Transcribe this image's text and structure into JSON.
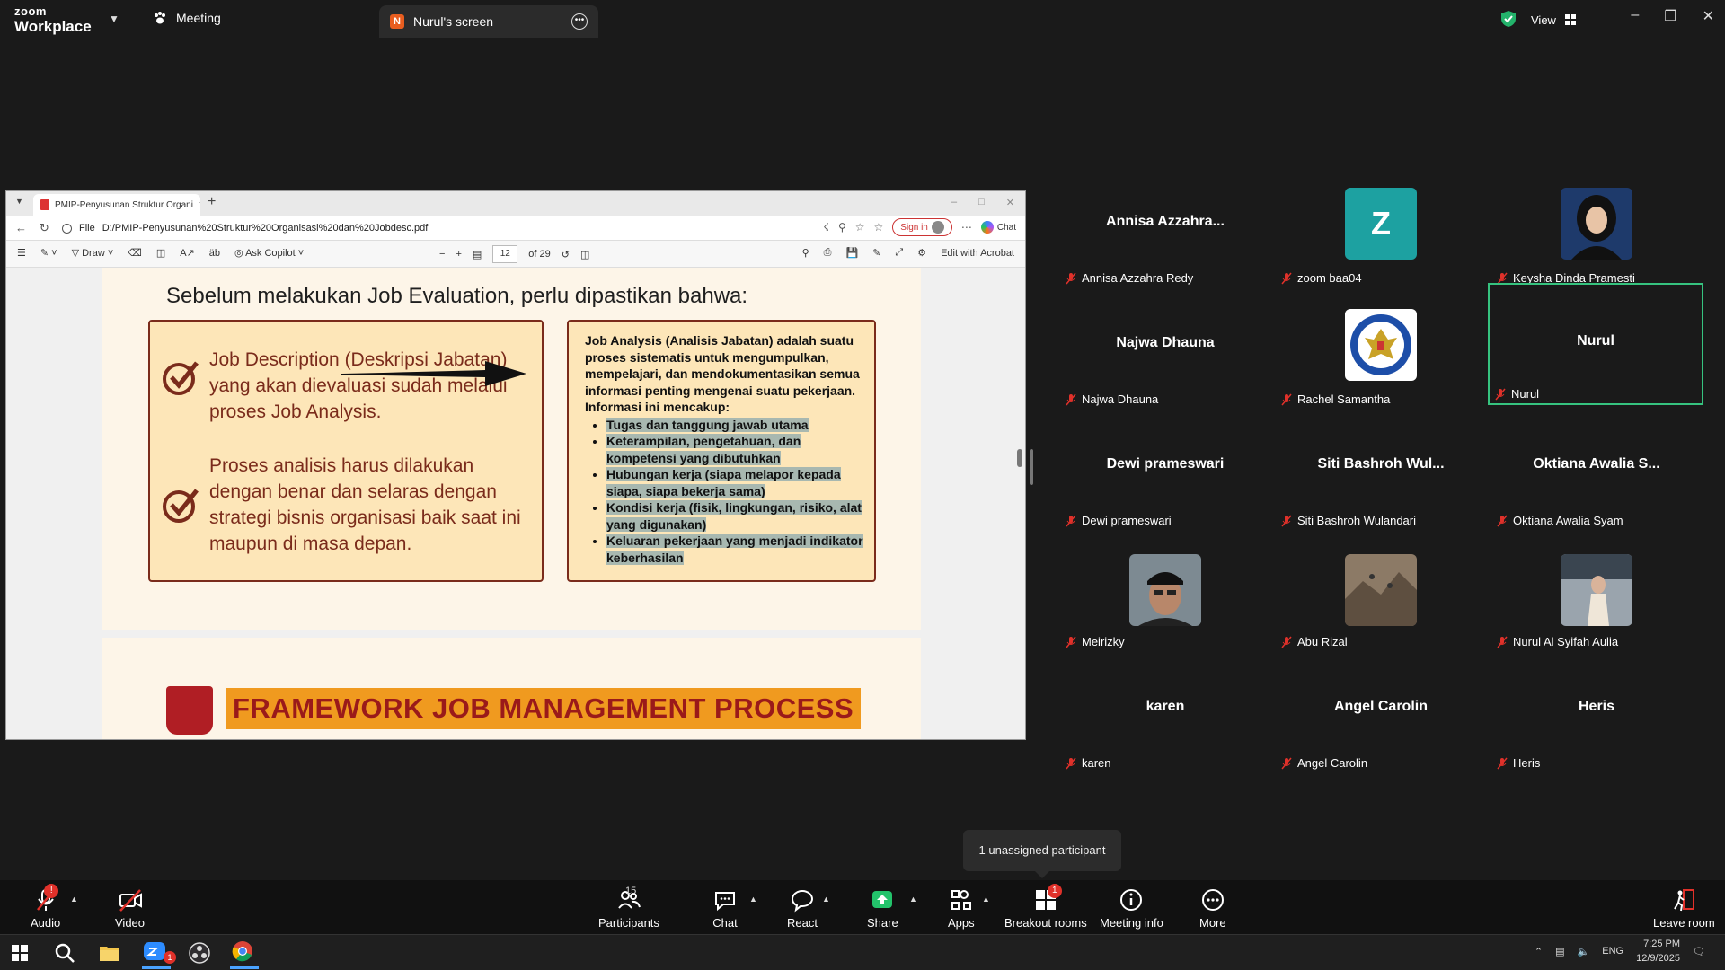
{
  "app": {
    "logo_top": "zoom",
    "logo_bottom": "Workplace",
    "meeting_label": "Meeting",
    "screen_tab_badge": "N",
    "screen_tab_label": "Nurul's screen",
    "view_label": "View"
  },
  "browser": {
    "tab_title": "PMIP-Penyusunan Struktur Organi",
    "url_prefix": "File",
    "url": "D:/PMIP-Penyusunan%20Struktur%20Organisasi%20dan%20Jobdesc.pdf",
    "signin_label": "Sign in",
    "chat_label": "Chat",
    "draw_label": "Draw",
    "copilot_label": "Ask Copilot",
    "page_current": "12",
    "page_total": "of 29",
    "edit_label": "Edit with Acrobat"
  },
  "pdf": {
    "heading": "Sebelum melakukan Job Evaluation, perlu dipastikan bahwa:",
    "left_point_1": "Job Description (Deskripsi Jabatan) yang akan dievaluasi sudah melalui proses Job Analysis.",
    "left_point_2": "Proses analisis harus dilakukan dengan benar dan selaras dengan strategi bisnis organisasi baik saat ini maupun di masa depan.",
    "right_intro": "Job Analysis (Analisis Jabatan) adalah suatu proses sistematis untuk mengumpulkan, mempelajari, dan mendokumentasikan semua informasi penting mengenai suatu pekerjaan. Informasi ini mencakup:",
    "right_items": [
      "Tugas dan tanggung jawab utama",
      "Keterampilan, pengetahuan, dan kompetensi yang dibutuhkan",
      "Hubungan kerja (siapa melapor kepada siapa, siapa bekerja sama)",
      "Kondisi kerja (fisik, lingkungan, risiko, alat yang digunakan)",
      "Keluaran pekerjaan yang menjadi indikator keberhasilan"
    ],
    "next_page_title": "FRAMEWORK JOB MANAGEMENT PROCESS"
  },
  "gallery": {
    "tiles": [
      {
        "big": "Annisa Azzahra...",
        "label": "Annisa Azzahra Redy"
      },
      {
        "big": "Z",
        "label": "zoom baa04"
      },
      {
        "big": "",
        "label": "Keysha Dinda Pramesti"
      },
      {
        "big": "Najwa Dhauna",
        "label": "Najwa Dhauna"
      },
      {
        "big": "",
        "label": "Rachel Samantha"
      },
      {
        "big": "Nurul",
        "label": "Nurul"
      },
      {
        "big": "Dewi prameswari",
        "label": "Dewi prameswari"
      },
      {
        "big": "Siti Bashroh Wul...",
        "label": "Siti Bashroh Wulandari"
      },
      {
        "big": "Oktiana Awalia S...",
        "label": "Oktiana Awalia Syam"
      },
      {
        "big": "",
        "label": "Meirizky"
      },
      {
        "big": "",
        "label": "Abu Rizal"
      },
      {
        "big": "",
        "label": "Nurul Al Syifah Aulia"
      },
      {
        "big": "karen",
        "label": "karen"
      },
      {
        "big": "Angel Carolin",
        "label": "Angel Carolin"
      },
      {
        "big": "Heris",
        "label": "Heris"
      }
    ]
  },
  "tooltip": "1 unassigned participant",
  "toolbar": {
    "audio": "Audio",
    "audio_badge": "!",
    "video": "Video",
    "participants": "Participants",
    "participants_count": "15",
    "chat": "Chat",
    "react": "React",
    "share": "Share",
    "apps": "Apps",
    "breakout": "Breakout rooms",
    "breakout_badge": "1",
    "info": "Meeting info",
    "more": "More",
    "leave": "Leave room"
  },
  "taskbar": {
    "zoom_badge": "1",
    "lang": "ENG",
    "time": "7:25 PM",
    "date": "12/9/2025"
  },
  "colors": {
    "accent_green": "#36c37f",
    "pdf_maroon": "#7a2b1b",
    "box_fill": "#fde6b8",
    "title_band": "#f09a1f"
  }
}
